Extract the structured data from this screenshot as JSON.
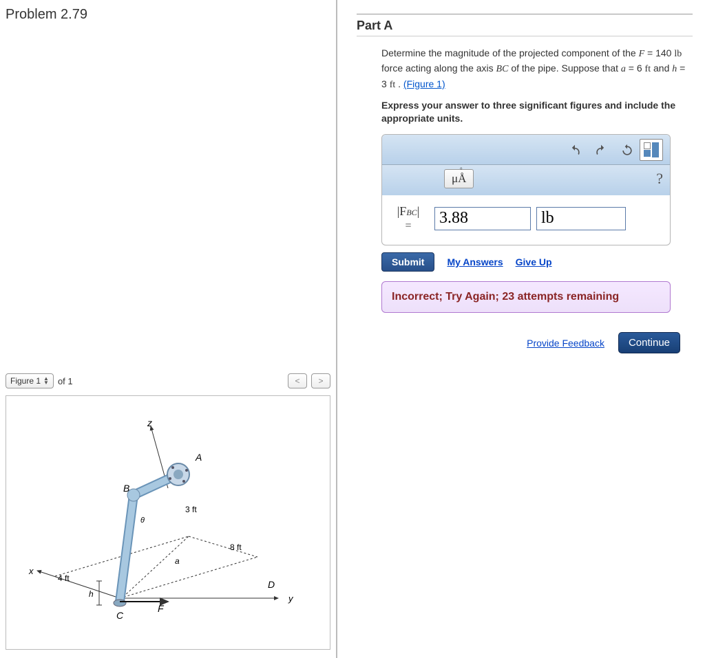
{
  "problem_title": "Problem 2.79",
  "figure": {
    "selector_label": "Figure 1",
    "of_label": "of 1",
    "labels": {
      "z": "z",
      "A": "A",
      "B": "B",
      "C": "C",
      "D": "D",
      "F": "F",
      "x": "x",
      "y": "y",
      "a": "a",
      "h": "h",
      "theta": "θ",
      "d3ft": "3 ft",
      "d8ft": "8 ft",
      "d4ft": "4 ft"
    }
  },
  "part": {
    "title": "Part A",
    "q1": "Determine the magnitude of the projected component of the ",
    "F": "F",
    "eq_f": " = 140 ",
    "lb_unit": "lb",
    "q2": " force acting along the axis ",
    "BC": "BC",
    "q3": " of the pipe. Suppose that ",
    "a_var": "a",
    "eq_a": " = 6 ",
    "ft_unit": "ft",
    "and": " and ",
    "h_var": "h",
    "eq_h": " = 3 ",
    "period": " . ",
    "figure_link": "(Figure 1)",
    "instruction": "Express your answer to three significant figures and include the appropriate units.",
    "units_btn": "μÅ",
    "help": "?",
    "answer_label_top": "|F",
    "answer_label_sub": "BC",
    "answer_label_close": "|",
    "equals": "=",
    "value": "3.88",
    "unit_value": "lb",
    "submit": "Submit",
    "my_answers": "My Answers",
    "give_up": "Give Up",
    "feedback": "Incorrect; Try Again; 23 attempts remaining",
    "provide_feedback": "Provide Feedback",
    "continue": "Continue"
  }
}
